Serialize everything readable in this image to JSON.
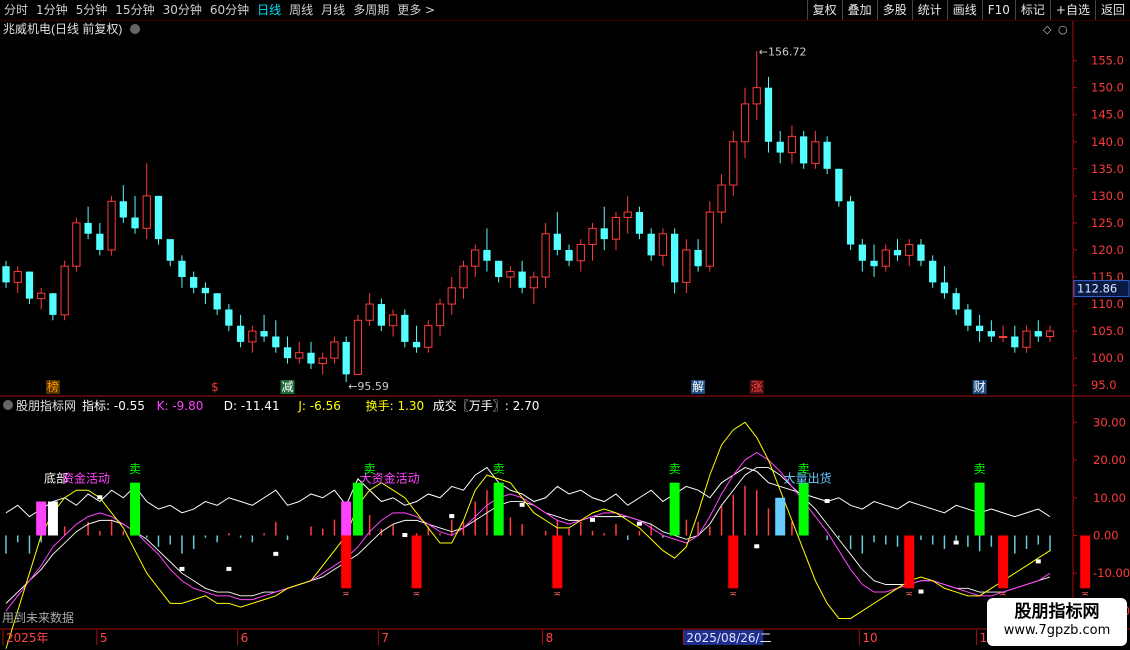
{
  "toolbar": {
    "periods": [
      "分时",
      "1分钟",
      "5分钟",
      "15分钟",
      "30分钟",
      "60分钟",
      "日线",
      "周线",
      "月线",
      "多周期",
      "更多 >"
    ],
    "active_period": "日线",
    "right_buttons": [
      "复权",
      "叠加",
      "多股",
      "统计",
      "画线",
      "F10",
      "标记",
      "+自选",
      "返回"
    ]
  },
  "main_panel": {
    "title": "兆威机电(日线 前复权)",
    "last_price_tag": "112.86",
    "high_label": "156.72",
    "low_label": "95.59",
    "event_markers": [
      {
        "text": "榜",
        "color": "#ff9900",
        "bg": "#553300",
        "index": 4
      },
      {
        "text": "$",
        "color": "#ff3333",
        "bg": "none",
        "index": 18
      },
      {
        "text": "减",
        "color": "#ffffff",
        "bg": "#1d6b3a",
        "index": 24
      },
      {
        "text": "解",
        "color": "#ffffff",
        "bg": "#1d4d80",
        "index": 59
      },
      {
        "text": "涨",
        "color": "#ff4444",
        "bg": "#551111",
        "index": 64
      },
      {
        "text": "财",
        "color": "#ffffff",
        "bg": "#1d4d80",
        "index": 83
      }
    ]
  },
  "sub_panel": {
    "title": "股朋指标网",
    "values": [
      {
        "label": "指标: -0.55",
        "color": "#ffffff"
      },
      {
        "label": "K: -9.80",
        "color": "#ff44ff"
      },
      {
        "label": "D: -11.41",
        "color": "#ffffff"
      },
      {
        "label": "J: -6.56",
        "color": "#ffff00"
      },
      {
        "label": "换手: 1.30",
        "color": "#ffff00"
      },
      {
        "label": "成交〖万手〗: 2.70",
        "color": "#ffffff"
      }
    ],
    "labels": [
      {
        "text": "底部",
        "color": "#ffffff",
        "index": 4
      },
      {
        "text": "资金活动",
        "color": "#ff44ff",
        "index": 7
      },
      {
        "text": "大资金活动",
        "color": "#ff44ff",
        "index": 31
      },
      {
        "text": "大量出货",
        "color": "#66ccff",
        "index": 68
      },
      {
        "text": "卖",
        "color": "#00ff00",
        "index": 11
      },
      {
        "text": "卖",
        "color": "#00ff00",
        "index": 31
      },
      {
        "text": "卖",
        "color": "#00ff00",
        "index": 42
      },
      {
        "text": "卖",
        "color": "#00ff00",
        "index": 57
      },
      {
        "text": "卖",
        "color": "#00ff00",
        "index": 68
      },
      {
        "text": "卖",
        "color": "#00ff00",
        "index": 83
      }
    ],
    "future_text": "用到未来数据"
  },
  "date_axis": {
    "labels": [
      {
        "text": "2025年",
        "index": 0
      },
      {
        "text": "5",
        "index": 8
      },
      {
        "text": "6",
        "index": 20
      },
      {
        "text": "7",
        "index": 32
      },
      {
        "text": "8",
        "index": 46
      },
      {
        "text": "2025/08/26/二",
        "index": 58,
        "highlight": true
      },
      {
        "text": "10",
        "index": 73
      },
      {
        "text": "11",
        "index": 83
      }
    ]
  },
  "watermark": {
    "line1": "股朋指标网",
    "line2": "www.7gpzb.com"
  },
  "chart_data": {
    "type": "candlestick",
    "price_axis": {
      "ticks": [
        95,
        100,
        105,
        110,
        115,
        120,
        125,
        130,
        135,
        140,
        145,
        150,
        155
      ],
      "range": [
        93,
        159
      ]
    },
    "indicator_axis": {
      "ticks": [
        -20,
        -10,
        0,
        10,
        20,
        30
      ],
      "range": [
        -24,
        33
      ]
    },
    "candles": [
      [
        117,
        118,
        113,
        114
      ],
      [
        114,
        117,
        112,
        116
      ],
      [
        116,
        116,
        110,
        111
      ],
      [
        111,
        113,
        109,
        112
      ],
      [
        112,
        112,
        107,
        108
      ],
      [
        108,
        118,
        107,
        117
      ],
      [
        117,
        126,
        116,
        125
      ],
      [
        125,
        128,
        122,
        123
      ],
      [
        123,
        125,
        119,
        120
      ],
      [
        120,
        130,
        119,
        129
      ],
      [
        129,
        132,
        125,
        126
      ],
      [
        126,
        130,
        123,
        124
      ],
      [
        124,
        136,
        122,
        130
      ],
      [
        130,
        130,
        121,
        122
      ],
      [
        122,
        122,
        117,
        118
      ],
      [
        118,
        119,
        113,
        115
      ],
      [
        115,
        116,
        112,
        113
      ],
      [
        113,
        114,
        110,
        112
      ],
      [
        112,
        112,
        108,
        109
      ],
      [
        109,
        110,
        105,
        106
      ],
      [
        106,
        108,
        102,
        103
      ],
      [
        103,
        106,
        101,
        105
      ],
      [
        105,
        108,
        103,
        104
      ],
      [
        104,
        107,
        101,
        102
      ],
      [
        102,
        104,
        99,
        100
      ],
      [
        100,
        103,
        99,
        101
      ],
      [
        101,
        103,
        98,
        99
      ],
      [
        99,
        101,
        97,
        100
      ],
      [
        100,
        104,
        99,
        103
      ],
      [
        103,
        104,
        95.59,
        97
      ],
      [
        97,
        108,
        97,
        107
      ],
      [
        107,
        112,
        106,
        110
      ],
      [
        110,
        111,
        105,
        106
      ],
      [
        106,
        109,
        104,
        108
      ],
      [
        108,
        109,
        102,
        103
      ],
      [
        103,
        106,
        101,
        102
      ],
      [
        102,
        107,
        101,
        106
      ],
      [
        106,
        111,
        104,
        110
      ],
      [
        110,
        115,
        108,
        113
      ],
      [
        113,
        118,
        111,
        117
      ],
      [
        117,
        121,
        115,
        120
      ],
      [
        120,
        124,
        116,
        118
      ],
      [
        118,
        118,
        114,
        115
      ],
      [
        115,
        117,
        113,
        116
      ],
      [
        116,
        118,
        112,
        113
      ],
      [
        113,
        116,
        110,
        115
      ],
      [
        115,
        125,
        113,
        123
      ],
      [
        123,
        127,
        119,
        120
      ],
      [
        120,
        121,
        117,
        118
      ],
      [
        118,
        122,
        116,
        121
      ],
      [
        121,
        125,
        118,
        124
      ],
      [
        124,
        128,
        120,
        122
      ],
      [
        122,
        127,
        120,
        126
      ],
      [
        126,
        130,
        123,
        127
      ],
      [
        127,
        128,
        122,
        123
      ],
      [
        123,
        124,
        118,
        119
      ],
      [
        119,
        124,
        117,
        123
      ],
      [
        123,
        124,
        112,
        114
      ],
      [
        114,
        122,
        112,
        120
      ],
      [
        120,
        122,
        116,
        117
      ],
      [
        117,
        129,
        116,
        127
      ],
      [
        127,
        134,
        125,
        132
      ],
      [
        132,
        142,
        130,
        140
      ],
      [
        140,
        150,
        137,
        147
      ],
      [
        147,
        156.72,
        144,
        150
      ],
      [
        150,
        152,
        138,
        140
      ],
      [
        140,
        142,
        136,
        138
      ],
      [
        138,
        143,
        136,
        141
      ],
      [
        141,
        142,
        135,
        136
      ],
      [
        136,
        142,
        135,
        140
      ],
      [
        140,
        141,
        134,
        135
      ],
      [
        135,
        135,
        128,
        129
      ],
      [
        129,
        130,
        120,
        121
      ],
      [
        121,
        122,
        116,
        118
      ],
      [
        118,
        121,
        115,
        117
      ],
      [
        117,
        121,
        116,
        120
      ],
      [
        120,
        122,
        118,
        119
      ],
      [
        119,
        122,
        117,
        121
      ],
      [
        121,
        122,
        117,
        118
      ],
      [
        118,
        119,
        113,
        114
      ],
      [
        114,
        117,
        111,
        112
      ],
      [
        112,
        113,
        108,
        109
      ],
      [
        109,
        110,
        105,
        106
      ],
      [
        106,
        108,
        103,
        105
      ],
      [
        105,
        107,
        103,
        104
      ],
      [
        104,
        106,
        103,
        104
      ],
      [
        104,
        106,
        101,
        102
      ],
      [
        102,
        106,
        101,
        105
      ],
      [
        105,
        107,
        103,
        104
      ],
      [
        104,
        106,
        103,
        105
      ]
    ],
    "indicator": {
      "white_line": [
        6,
        8,
        5,
        7,
        9,
        10,
        8,
        11,
        9,
        12,
        10,
        13,
        9,
        7,
        8,
        6,
        7,
        9,
        8,
        10,
        9,
        8,
        10,
        12,
        8,
        9,
        11,
        10,
        12,
        8,
        15,
        12,
        9,
        10,
        8,
        9,
        11,
        10,
        13,
        12,
        16,
        18,
        14,
        12,
        11,
        9,
        10,
        13,
        11,
        12,
        10,
        9,
        11,
        8,
        10,
        12,
        9,
        11,
        13,
        12,
        10,
        14,
        16,
        18,
        17,
        14,
        13,
        12,
        11,
        10,
        9,
        10,
        8,
        7,
        9,
        8,
        7,
        9,
        8,
        7,
        6,
        8,
        7,
        6,
        7,
        6,
        5,
        6,
        7,
        5
      ],
      "k_line": [
        -20,
        -16,
        -12,
        -8,
        -3,
        0,
        3,
        5,
        6,
        5,
        3,
        1,
        -2,
        -5,
        -9,
        -12,
        -14,
        -15,
        -16,
        -16,
        -17,
        -17,
        -16,
        -15,
        -14,
        -13,
        -12,
        -10,
        -8,
        -6,
        -3,
        1,
        4,
        6,
        6,
        5,
        3,
        1,
        0,
        2,
        5,
        8,
        10,
        11,
        10,
        8,
        6,
        4,
        3,
        4,
        5,
        6,
        6,
        5,
        4,
        2,
        0,
        -1,
        -2,
        0,
        5,
        11,
        16,
        20,
        22,
        20,
        17,
        13,
        9,
        5,
        1,
        -4,
        -9,
        -13,
        -15,
        -15,
        -14,
        -13,
        -12,
        -12,
        -13,
        -14,
        -15,
        -16,
        -16,
        -15,
        -14,
        -13,
        -12,
        -10
      ],
      "d_line": [
        -18,
        -15,
        -12,
        -9,
        -5,
        -2,
        1,
        3,
        4,
        4,
        3,
        1,
        -1,
        -4,
        -7,
        -10,
        -12,
        -14,
        -15,
        -15,
        -16,
        -16,
        -15,
        -15,
        -14,
        -13,
        -12,
        -11,
        -9,
        -7,
        -5,
        -2,
        1,
        3,
        4,
        4,
        3,
        2,
        1,
        2,
        4,
        6,
        8,
        9,
        9,
        8,
        6,
        5,
        4,
        4,
        5,
        5,
        5,
        5,
        4,
        3,
        1,
        0,
        -1,
        0,
        3,
        8,
        12,
        16,
        18,
        18,
        16,
        13,
        10,
        7,
        3,
        -1,
        -5,
        -9,
        -12,
        -13,
        -13,
        -13,
        -12,
        -12,
        -13,
        -14,
        -14,
        -15,
        -15,
        -15,
        -14,
        -13,
        -12,
        -11
      ],
      "j_line": [
        -30,
        -20,
        -10,
        0,
        6,
        10,
        12,
        12,
        10,
        6,
        2,
        -4,
        -10,
        -14,
        -18,
        -18,
        -17,
        -16,
        -18,
        -18,
        -19,
        -18,
        -17,
        -16,
        -14,
        -13,
        -12,
        -8,
        -4,
        0,
        8,
        12,
        14,
        12,
        10,
        6,
        2,
        -2,
        -2,
        4,
        12,
        16,
        15,
        14,
        10,
        6,
        4,
        2,
        2,
        4,
        6,
        7,
        6,
        4,
        2,
        -1,
        -4,
        -6,
        -3,
        6,
        16,
        24,
        28,
        30,
        26,
        20,
        12,
        4,
        -4,
        -12,
        -18,
        -22,
        -22,
        -20,
        -18,
        -16,
        -14,
        -12,
        -11,
        -12,
        -14,
        -15,
        -16,
        -16,
        -14,
        -12,
        -10,
        -8,
        -6,
        -4
      ],
      "signal_bars": [
        {
          "index": 3,
          "color": "#ff44ff",
          "low": 0,
          "high": 9
        },
        {
          "index": 4,
          "color": "#ffffff",
          "low": 0,
          "high": 9
        },
        {
          "index": 11,
          "color": "#00ff00",
          "low": 0,
          "high": 14
        },
        {
          "index": 29,
          "color": "#ff44ff",
          "low": 0,
          "high": 9
        },
        {
          "index": 30,
          "color": "#00ff00",
          "low": 0,
          "high": 14
        },
        {
          "index": 42,
          "color": "#00ff00",
          "low": 0,
          "high": 14
        },
        {
          "index": 57,
          "color": "#00ff00",
          "low": 0,
          "high": 14
        },
        {
          "index": 66,
          "color": "#66ccff",
          "low": 0,
          "high": 10
        },
        {
          "index": 68,
          "color": "#00ff00",
          "low": 0,
          "high": 14
        },
        {
          "index": 83,
          "color": "#00ff00",
          "low": 0,
          "high": 14
        },
        {
          "index": 29,
          "color": "#ff0000",
          "low": -14,
          "high": 0
        },
        {
          "index": 35,
          "color": "#ff0000",
          "low": -14,
          "high": 0
        },
        {
          "index": 47,
          "color": "#ff0000",
          "low": -14,
          "high": 0
        },
        {
          "index": 62,
          "color": "#ff0000",
          "low": -14,
          "high": 0
        },
        {
          "index": 77,
          "color": "#ff0000",
          "low": -14,
          "high": 0
        },
        {
          "index": 85,
          "color": "#ff0000",
          "low": -14,
          "high": 0
        },
        {
          "index": 92,
          "color": "#ff0000",
          "low": -14,
          "high": 0
        }
      ],
      "dots": [
        [
          8,
          10
        ],
        [
          15,
          -9
        ],
        [
          19,
          -9
        ],
        [
          23,
          -5
        ],
        [
          34,
          0
        ],
        [
          38,
          5
        ],
        [
          44,
          8
        ],
        [
          50,
          4
        ],
        [
          54,
          3
        ],
        [
          64,
          -3
        ],
        [
          70,
          9
        ],
        [
          78,
          -15
        ],
        [
          81,
          -2
        ],
        [
          88,
          -7
        ]
      ]
    },
    "grid": false
  }
}
